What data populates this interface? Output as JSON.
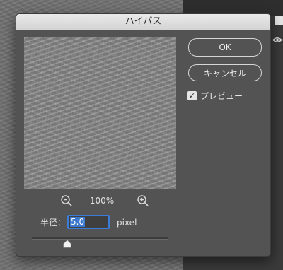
{
  "dialog": {
    "title": "ハイパス",
    "ok_label": "OK",
    "cancel_label": "キャンセル",
    "preview_label": "プレビュー",
    "preview_checked": true
  },
  "zoom": {
    "value": "100%",
    "zoom_out_icon": "zoom-out-icon",
    "zoom_in_icon": "zoom-in-icon"
  },
  "radius": {
    "label": "半径：",
    "value": "5.0",
    "unit": "pixel",
    "slider_level": 0.26
  },
  "colors": {
    "dialog_bg": "#535353",
    "accent": "#3d7bd8",
    "titlebar": "#dcdcdc"
  }
}
